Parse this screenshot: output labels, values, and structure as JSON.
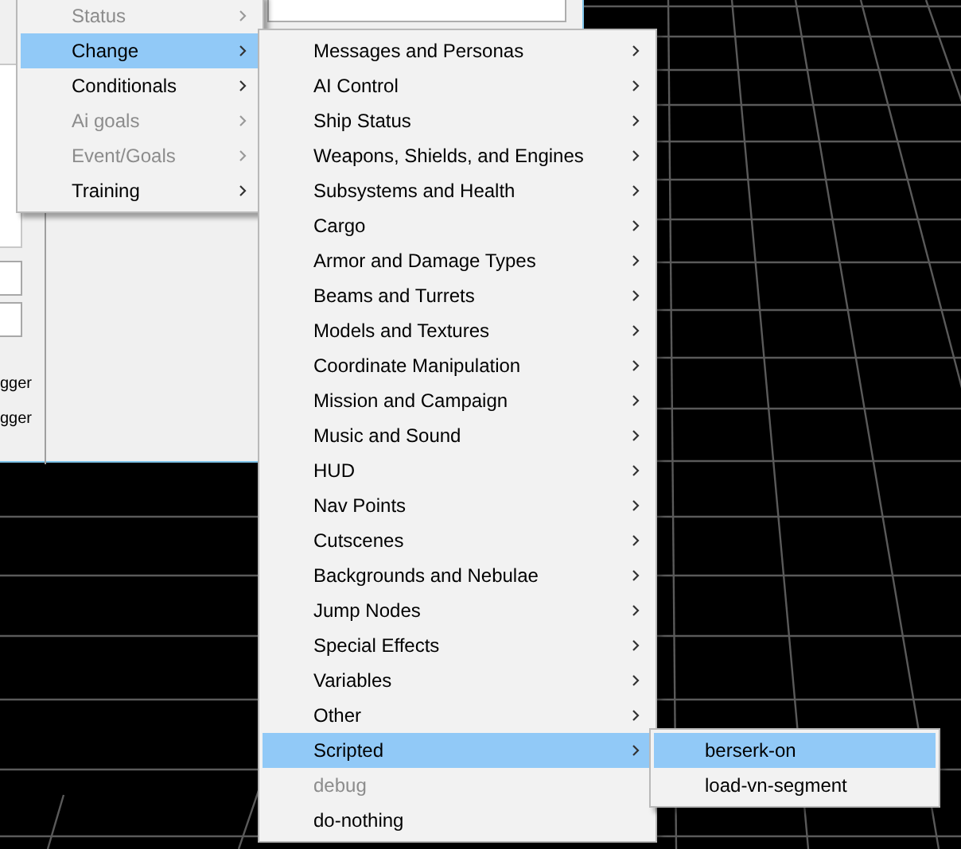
{
  "dialog": {
    "labels": [
      "gger",
      "gger"
    ]
  },
  "menus": [
    {
      "items": [
        {
          "label": "Status",
          "disabled": true,
          "selected": false,
          "submenu": true
        },
        {
          "label": "Change",
          "disabled": false,
          "selected": true,
          "submenu": true
        },
        {
          "label": "Conditionals",
          "disabled": false,
          "selected": false,
          "submenu": true
        },
        {
          "label": "Ai goals",
          "disabled": true,
          "selected": false,
          "submenu": true
        },
        {
          "label": "Event/Goals",
          "disabled": true,
          "selected": false,
          "submenu": true
        },
        {
          "label": "Training",
          "disabled": false,
          "selected": false,
          "submenu": true
        }
      ]
    },
    {
      "items": [
        {
          "label": "Messages and Personas",
          "disabled": false,
          "selected": false,
          "submenu": true
        },
        {
          "label": "AI Control",
          "disabled": false,
          "selected": false,
          "submenu": true
        },
        {
          "label": "Ship Status",
          "disabled": false,
          "selected": false,
          "submenu": true
        },
        {
          "label": "Weapons, Shields, and Engines",
          "disabled": false,
          "selected": false,
          "submenu": true
        },
        {
          "label": "Subsystems and Health",
          "disabled": false,
          "selected": false,
          "submenu": true
        },
        {
          "label": "Cargo",
          "disabled": false,
          "selected": false,
          "submenu": true
        },
        {
          "label": "Armor and Damage Types",
          "disabled": false,
          "selected": false,
          "submenu": true
        },
        {
          "label": "Beams and Turrets",
          "disabled": false,
          "selected": false,
          "submenu": true
        },
        {
          "label": "Models and Textures",
          "disabled": false,
          "selected": false,
          "submenu": true
        },
        {
          "label": "Coordinate Manipulation",
          "disabled": false,
          "selected": false,
          "submenu": true
        },
        {
          "label": "Mission and Campaign",
          "disabled": false,
          "selected": false,
          "submenu": true
        },
        {
          "label": "Music and Sound",
          "disabled": false,
          "selected": false,
          "submenu": true
        },
        {
          "label": "HUD",
          "disabled": false,
          "selected": false,
          "submenu": true
        },
        {
          "label": "Nav Points",
          "disabled": false,
          "selected": false,
          "submenu": true
        },
        {
          "label": "Cutscenes",
          "disabled": false,
          "selected": false,
          "submenu": true
        },
        {
          "label": "Backgrounds and Nebulae",
          "disabled": false,
          "selected": false,
          "submenu": true
        },
        {
          "label": "Jump Nodes",
          "disabled": false,
          "selected": false,
          "submenu": true
        },
        {
          "label": "Special Effects",
          "disabled": false,
          "selected": false,
          "submenu": true
        },
        {
          "label": "Variables",
          "disabled": false,
          "selected": false,
          "submenu": true
        },
        {
          "label": "Other",
          "disabled": false,
          "selected": false,
          "submenu": true
        },
        {
          "label": "Scripted",
          "disabled": false,
          "selected": true,
          "submenu": true
        },
        {
          "label": "debug",
          "disabled": true,
          "selected": false,
          "submenu": false
        },
        {
          "label": "do-nothing",
          "disabled": false,
          "selected": false,
          "submenu": false
        }
      ]
    },
    {
      "items": [
        {
          "label": "berserk-on",
          "disabled": false,
          "selected": true,
          "submenu": false
        },
        {
          "label": "load-vn-segment",
          "disabled": false,
          "selected": false,
          "submenu": false
        }
      ]
    }
  ]
}
